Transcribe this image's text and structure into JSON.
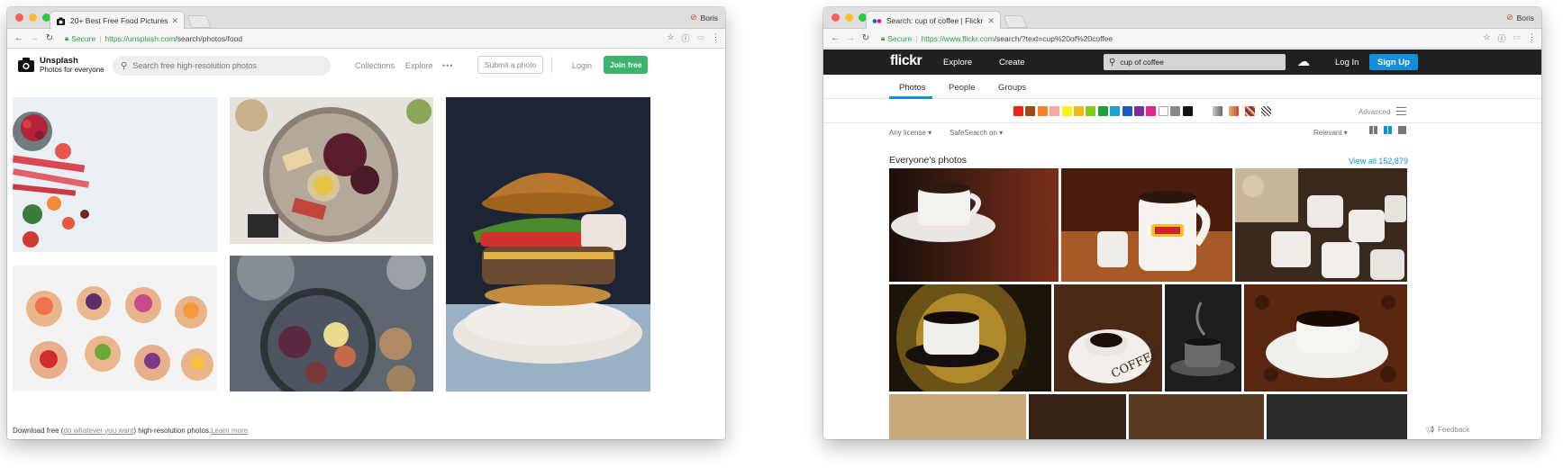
{
  "left_window": {
    "tab_title": "20+ Best Free Food Pictures o",
    "profile_name": "Boris",
    "secure_label": "Secure",
    "url_host": "https://unsplash.com",
    "url_path": "/search/photos/food",
    "brand_name": "Unsplash",
    "brand_tagline": "Photos for everyone",
    "search_placeholder": "Search free high-resolution photos",
    "nav_collections": "Collections",
    "nav_explore": "Explore",
    "more_label": "•••",
    "submit_label": "Submit a photo",
    "login_label": "Login",
    "join_label": "Join free",
    "footer_prefix": "Download free (",
    "footer_link": "do whatever you want",
    "footer_middle": ") high-resolution photos. ",
    "footer_learn": "Learn more"
  },
  "right_window": {
    "tab_title": "Search: cup of coffee | Flickr",
    "profile_name": "Boris",
    "secure_label": "Secure",
    "url_host": "https://www.flickr.com",
    "url_path": "/search/?text=cup%20of%20coffee",
    "logo": "flickr",
    "nav_explore": "Explore",
    "nav_create": "Create",
    "search_value": "cup of coffee",
    "login_label": "Log In",
    "signup_label": "Sign Up",
    "tabs": [
      "Photos",
      "People",
      "Groups"
    ],
    "advanced_label": "Advanced",
    "filter_license": "Any license",
    "filter_safesearch": "SafeSearch on",
    "sort_label": "Relevant",
    "section_title": "Everyone's photos",
    "view_all": "View all 152,879",
    "feedback_label": "Feedback",
    "colors": [
      "#e8231a",
      "#9b4a18",
      "#f28421",
      "#f7a4a6",
      "#f9ef1a",
      "#f5b71c",
      "#84c91d",
      "#1aa138",
      "#17a6cf",
      "#1a5bbd",
      "#7b2ca4",
      "#e0258e",
      "#ffffff",
      "#888888",
      "#111111"
    ]
  }
}
